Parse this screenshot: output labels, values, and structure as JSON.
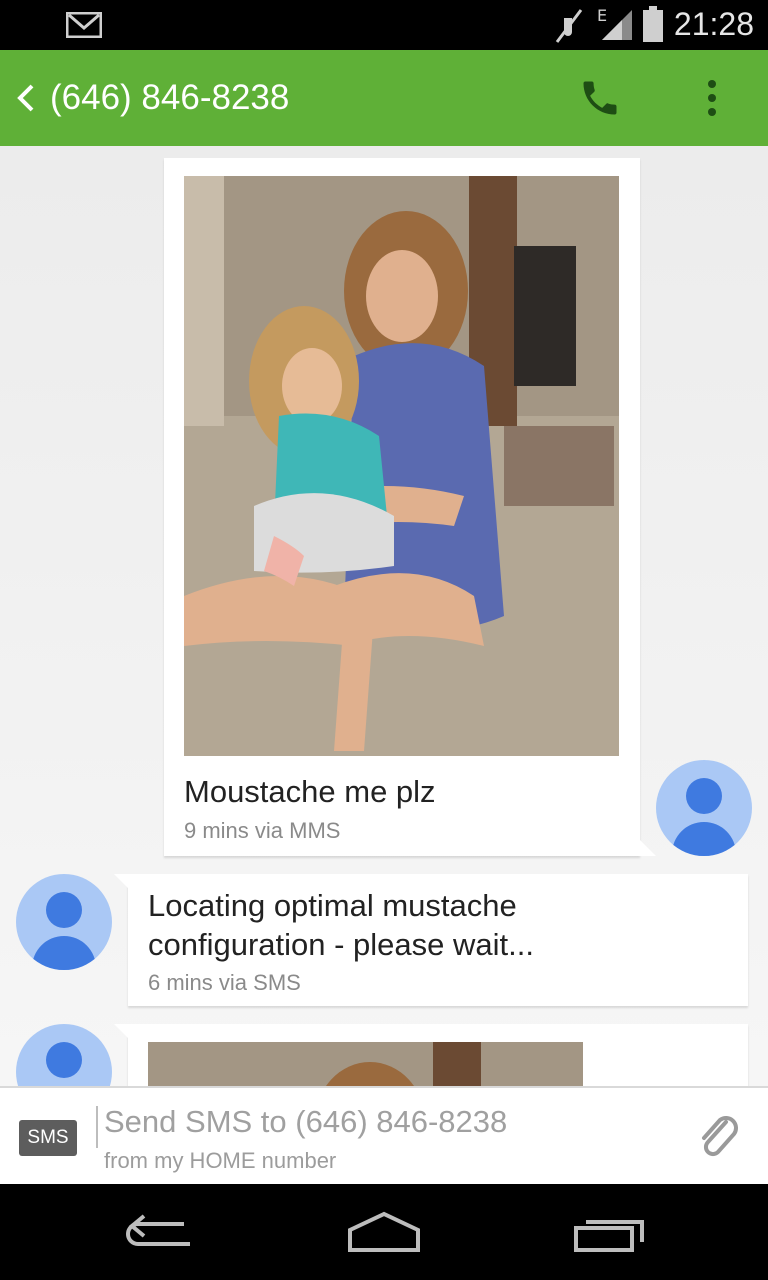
{
  "status_bar": {
    "time": "21:28",
    "icons": [
      "gmail-icon",
      "mute-icon",
      "edge-network-icon",
      "signal-icon",
      "battery-icon"
    ]
  },
  "app_bar": {
    "title": "(646) 846-8238",
    "icons": [
      "back-icon",
      "phone-icon",
      "overflow-menu-icon"
    ],
    "accent_color": "#5fb037"
  },
  "messages": [
    {
      "direction": "outgoing",
      "has_photo": true,
      "text": "Moustache me plz",
      "meta": "9 mins via MMS"
    },
    {
      "direction": "incoming",
      "text_line1": "Locating optimal mustache",
      "text_line2": "configuration - please wait...",
      "meta": "6 mins via SMS"
    },
    {
      "direction": "incoming",
      "has_photo": true
    }
  ],
  "composer": {
    "badge": "SMS",
    "placeholder": "Send SMS to (646) 846-8238",
    "sub": "from my HOME number",
    "attach_icon": "paperclip-icon"
  },
  "nav_bar": {
    "icons": [
      "back-nav-icon",
      "home-nav-icon",
      "recents-nav-icon"
    ]
  }
}
